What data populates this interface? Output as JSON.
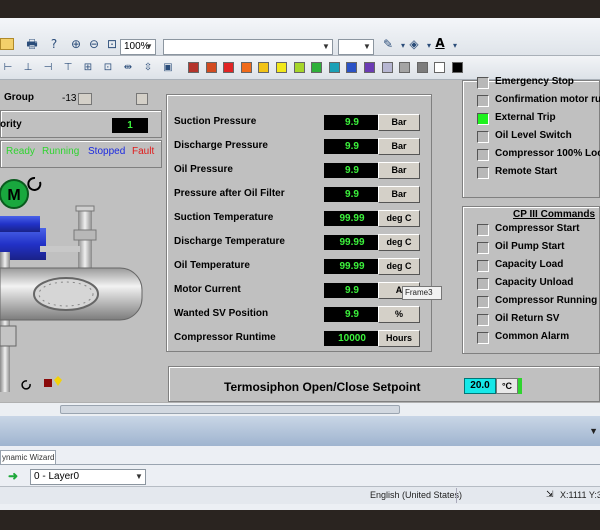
{
  "toolbar": {
    "zoom": "100%",
    "font_combo": "",
    "size_combo": ""
  },
  "swatches": [
    "#b4342c",
    "#d24a20",
    "#e02424",
    "#f06a1a",
    "#f2c316",
    "#f2e81a",
    "#a6d62a",
    "#2eb03a",
    "#1aa0b6",
    "#2a52c6",
    "#6b3bb4",
    "#b6b6d2",
    "#a4a4a4",
    "#7c7c7c",
    "#ffffff",
    "#000000"
  ],
  "left": {
    "group_label": "Group",
    "group_value": "-13",
    "priority_label": "ority",
    "priority_value": "1",
    "legend": {
      "ready": "Ready",
      "running": "Running",
      "stopped": "Stopped",
      "fault": "Fault"
    },
    "motor_letter": "M"
  },
  "measurements": [
    {
      "label": "Suction Pressure",
      "value": "9.9",
      "unit": "Bar"
    },
    {
      "label": "Discharge Pressure",
      "value": "9.9",
      "unit": "Bar"
    },
    {
      "label": "Oil Pressure",
      "value": "9.9",
      "unit": "Bar"
    },
    {
      "label": "Pressure after Oil Filter",
      "value": "9.9",
      "unit": "Bar"
    },
    {
      "label": "Suction Temperature",
      "value": "99.99",
      "unit": "deg C"
    },
    {
      "label": "Discharge Temperature",
      "value": "99.99",
      "unit": "deg C"
    },
    {
      "label": "Oil Temperature",
      "value": "99.99",
      "unit": "deg C"
    },
    {
      "label": "Motor Current",
      "value": "9.9",
      "unit": "A"
    },
    {
      "label": "Wanted  SV Position",
      "value": "9.9",
      "unit": "%"
    },
    {
      "label": "Compressor Runtime",
      "value": "10000",
      "unit": "Hours"
    }
  ],
  "tooltip": "Frame3",
  "status_top": {
    "items": [
      {
        "label": "Emergency Stop",
        "active": false
      },
      {
        "label": "Confirmation motor run",
        "active": false
      },
      {
        "label": "External Trip",
        "active": true
      },
      {
        "label": "Oil Level Switch",
        "active": false
      },
      {
        "label": "Compressor 100% Loc",
        "active": false
      },
      {
        "label": "Remote Start",
        "active": false
      }
    ]
  },
  "cp3": {
    "title": "CP III Commands",
    "items": [
      {
        "label": "Compressor Start"
      },
      {
        "label": "Oil Pump Start"
      },
      {
        "label": "Capacity Load"
      },
      {
        "label": "Capacity Unload"
      },
      {
        "label": "Compressor Running a"
      },
      {
        "label": "Oil Return SV"
      },
      {
        "label": "Common Alarm"
      }
    ]
  },
  "setpoint": {
    "label": "Termosiphon Open/Close Setpoint",
    "value": "20.0",
    "unit": "°C"
  },
  "bottom": {
    "tab": "ynamic Wizard",
    "layer": "0 - Layer0",
    "language": "English (United States)",
    "coords": "X:1111 Y:35"
  }
}
